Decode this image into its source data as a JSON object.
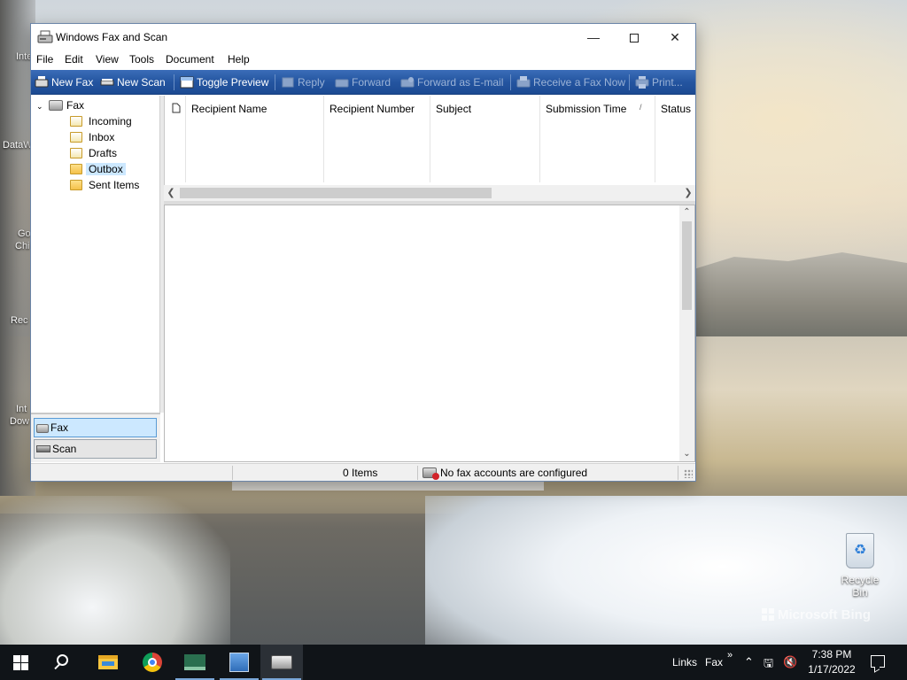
{
  "window": {
    "title": "Windows Fax and Scan"
  },
  "menu": {
    "items": [
      "File",
      "Edit",
      "View",
      "Tools",
      "Document",
      "Help"
    ]
  },
  "toolbar": {
    "new_fax": "New Fax",
    "new_scan": "New Scan",
    "toggle_preview": "Toggle Preview",
    "reply": "Reply",
    "forward": "Forward",
    "forward_email": "Forward as E-mail",
    "receive_fax": "Receive a Fax Now",
    "print": "Print..."
  },
  "nav": {
    "root": "Fax",
    "folders": [
      {
        "label": "Incoming",
        "selected": false
      },
      {
        "label": "Inbox",
        "selected": false
      },
      {
        "label": "Drafts",
        "selected": false
      },
      {
        "label": "Outbox",
        "selected": true
      },
      {
        "label": "Sent Items",
        "selected": false
      }
    ],
    "bottom_buttons": [
      {
        "label": "Fax",
        "active": true
      },
      {
        "label": "Scan",
        "active": false
      }
    ]
  },
  "list": {
    "columns": [
      "Recipient Name",
      "Recipient Number",
      "Subject",
      "Submission Time",
      "Status"
    ],
    "sort_indicator": "/",
    "rows": []
  },
  "status": {
    "items_count": "0 Items",
    "message": "No fax accounts are configured"
  },
  "desktop": {
    "recycle_bin": "Recycle Bin",
    "watermark": "Microsoft Bing",
    "partial_labels": [
      "Inte",
      "DataW",
      "Go",
      "Chi",
      "Rec",
      "Int",
      "Dow"
    ]
  },
  "taskbar": {
    "links": "Links",
    "fax": "Fax",
    "chevron": "»",
    "time": "7:38 PM",
    "date": "1/17/2022"
  },
  "colors": {
    "toolbar_blue": "#2455a0",
    "selection": "#cce8ff",
    "taskbar": "#101418"
  }
}
